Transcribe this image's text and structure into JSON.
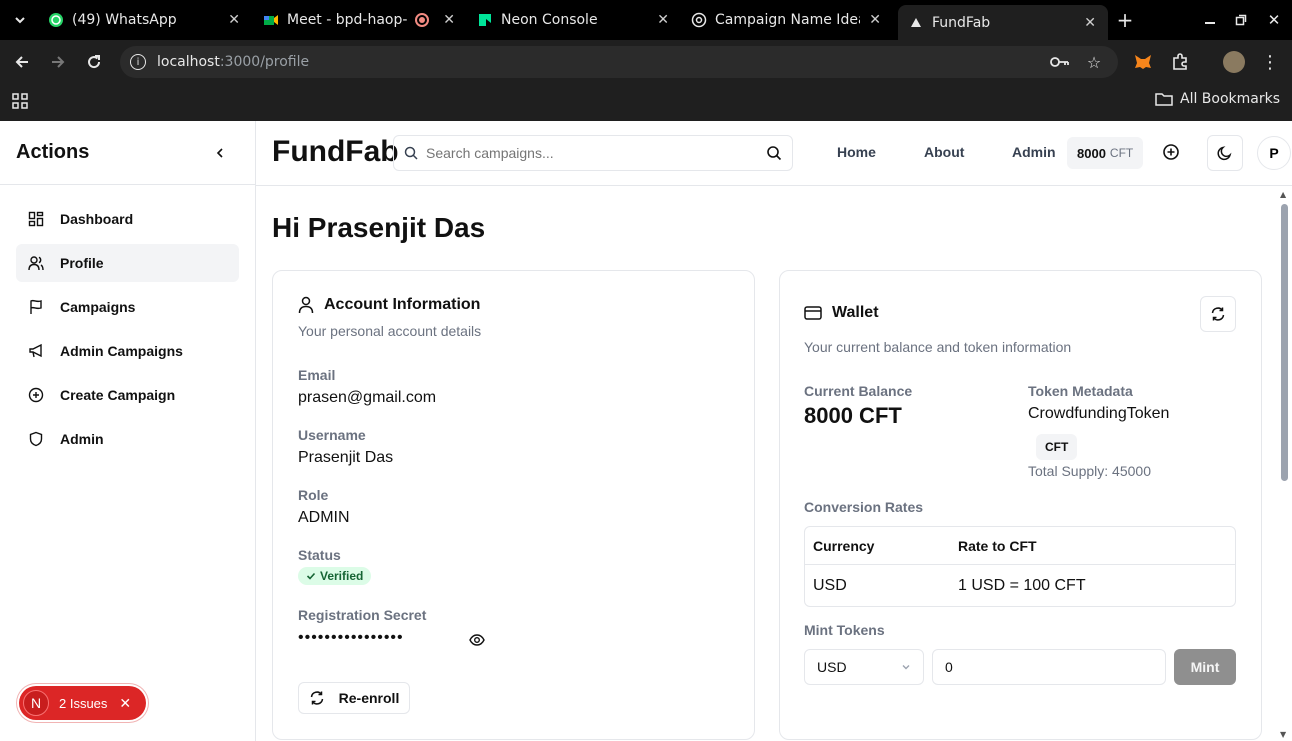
{
  "browser": {
    "tabs": [
      {
        "title": "(49) WhatsApp",
        "icon": "whatsapp-icon"
      },
      {
        "title": "Meet - bpd-haop-j",
        "icon": "meet-icon"
      },
      {
        "title": "Neon Console",
        "icon": "neon-icon"
      },
      {
        "title": "Campaign Name Idea",
        "icon": "chatgpt-icon"
      },
      {
        "title": "FundFab",
        "icon": "vercel-icon"
      }
    ],
    "url_host": "localhost",
    "url_path": ":3000/profile",
    "bookmarks_label": "All Bookmarks"
  },
  "sidebar": {
    "title": "Actions",
    "items": [
      {
        "label": "Dashboard",
        "icon": "dashboard-icon"
      },
      {
        "label": "Profile",
        "icon": "users-icon"
      },
      {
        "label": "Campaigns",
        "icon": "flag-icon"
      },
      {
        "label": "Admin Campaigns",
        "icon": "megaphone-icon"
      },
      {
        "label": "Create Campaign",
        "icon": "plus-circle-icon"
      },
      {
        "label": "Admin",
        "icon": "shield-icon"
      }
    ],
    "active_index": 1
  },
  "header": {
    "brand": "FundFab",
    "search_placeholder": "Search campaigns...",
    "nav": [
      "Home",
      "About",
      "Admin"
    ],
    "balance_amount": "8000",
    "balance_unit": "CFT",
    "avatar_letter": "P"
  },
  "main": {
    "greeting": "Hi Prasenjit Das"
  },
  "account": {
    "title": "Account Information",
    "subtitle": "Your personal account details",
    "email_label": "Email",
    "email": "prasen@gmail.com",
    "username_label": "Username",
    "username": "Prasenjit Das",
    "role_label": "Role",
    "role": "ADMIN",
    "status_label": "Status",
    "status": "Verified",
    "secret_label": "Registration Secret",
    "secret_masked": "••••••••••••••••",
    "reenroll_label": "Re-enroll"
  },
  "wallet": {
    "title": "Wallet",
    "subtitle": "Your current balance and token information",
    "balance_label": "Current Balance",
    "balance": "8000 CFT",
    "meta_label": "Token Metadata",
    "token_name": "CrowdfundingToken",
    "token_symbol": "CFT",
    "total_supply": "Total Supply: 45000",
    "rates_label": "Conversion Rates",
    "rates_headers": [
      "Currency",
      "Rate to CFT"
    ],
    "rates_rows": [
      [
        "USD",
        "1 USD = 100 CFT"
      ]
    ],
    "mint_label": "Mint Tokens",
    "mint_currency": "USD",
    "mint_amount": "0",
    "mint_button": "Mint"
  },
  "dev_overlay": {
    "letter": "N",
    "issues": "2 Issues"
  }
}
